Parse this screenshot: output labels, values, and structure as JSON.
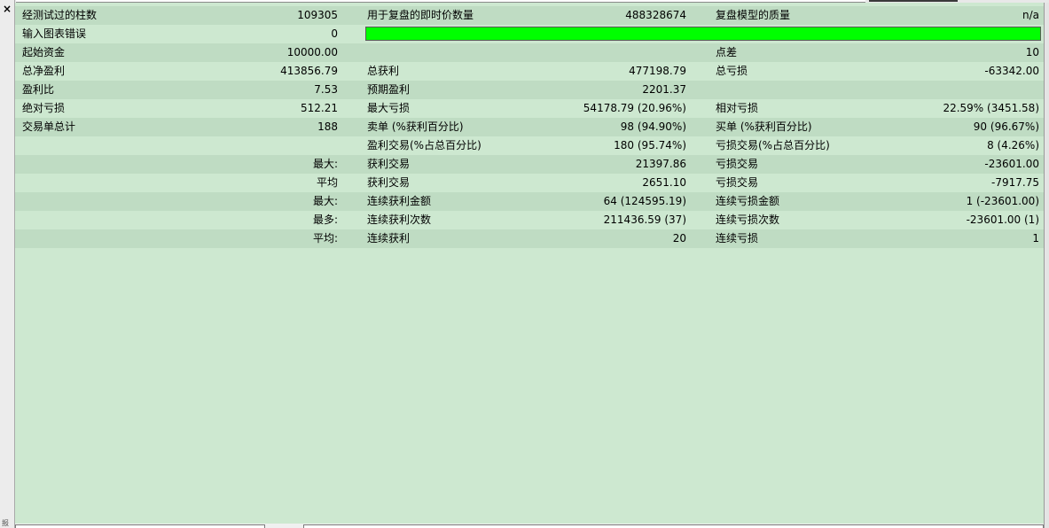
{
  "window": {
    "close_glyph": "×",
    "bottom_label": "报"
  },
  "colors": {
    "background": "#cde8d0",
    "alt_row": "#bfdcc3",
    "quality_bar": "#00ff00"
  },
  "rows": [
    {
      "c1": "经测试过的柱数",
      "c2": "109305",
      "c3": "用于复盘的即时价数量",
      "c4": "488328674",
      "c5": "复盘模型的质量",
      "c6": "n/a"
    },
    {
      "c1": "输入图表错误",
      "c2": "0",
      "c3": "",
      "c4": "",
      "c5": "",
      "c6": ""
    },
    {
      "c1": "起始资金",
      "c2": "10000.00",
      "c3": "",
      "c4": "",
      "c5": "点差",
      "c6": "10"
    },
    {
      "c1": "总净盈利",
      "c2": "413856.79",
      "c3": "总获利",
      "c4": "477198.79",
      "c5": "总亏损",
      "c6": "-63342.00"
    },
    {
      "c1": "盈利比",
      "c2": "7.53",
      "c3": "预期盈利",
      "c4": "2201.37",
      "c5": "",
      "c6": ""
    },
    {
      "c1": "绝对亏损",
      "c2": "512.21",
      "c3": "最大亏损",
      "c4": "54178.79 (20.96%)",
      "c5": "相对亏损",
      "c6": "22.59% (3451.58)"
    },
    {
      "c1": "交易单总计",
      "c2": "188",
      "c3": "卖单 (%获利百分比)",
      "c4": "98 (94.90%)",
      "c5": "买单 (%获利百分比)",
      "c6": "90 (96.67%)"
    },
    {
      "c1": "",
      "c2": "",
      "c3": "盈利交易(%占总百分比)",
      "c4": "180 (95.74%)",
      "c5": "亏损交易(%占总百分比)",
      "c6": "8 (4.26%)"
    },
    {
      "c1": "",
      "c2": "最大:",
      "c3": "获利交易",
      "c4": "21397.86",
      "c5": "亏损交易",
      "c6": "-23601.00"
    },
    {
      "c1": "",
      "c2": "平均",
      "c3": "获利交易",
      "c4": "2651.10",
      "c5": "亏损交易",
      "c6": "-7917.75"
    },
    {
      "c1": "",
      "c2": "最大:",
      "c3": "连续获利金额",
      "c4": "64 (124595.19)",
      "c5": "连续亏损金额",
      "c6": "1 (-23601.00)"
    },
    {
      "c1": "",
      "c2": "最多:",
      "c3": "连续获利次数",
      "c4": "211436.59 (37)",
      "c5": "连续亏损次数",
      "c6": "-23601.00 (1)"
    },
    {
      "c1": "",
      "c2": "平均:",
      "c3": "连续获利",
      "c4": "20",
      "c5": "连续亏损",
      "c6": "1"
    }
  ]
}
